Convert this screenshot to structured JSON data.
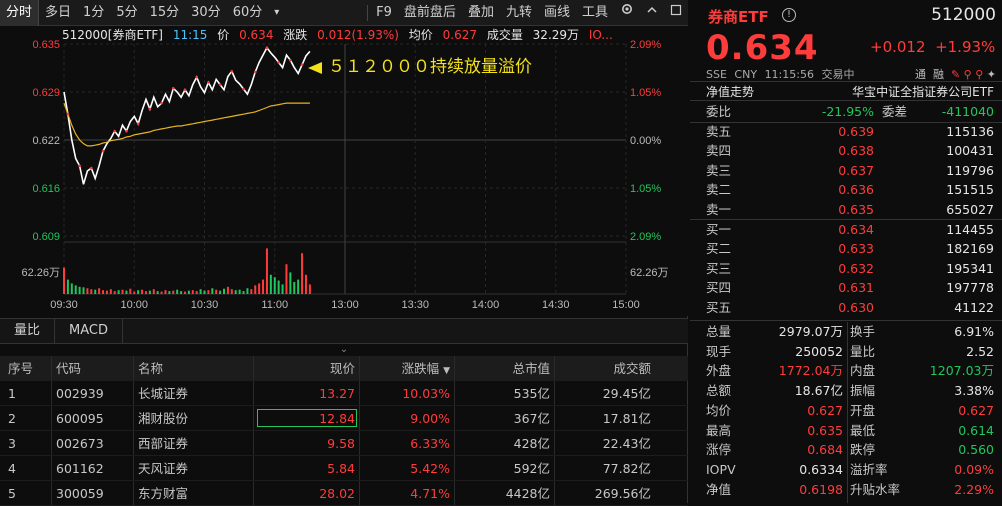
{
  "toolbar": {
    "tabs": [
      "分时",
      "多日",
      "1分",
      "5分",
      "15分",
      "30分",
      "60分",
      "▾"
    ],
    "tools": [
      "F9",
      "盘前盘后",
      "叠加",
      "九转",
      "画线",
      "工具"
    ]
  },
  "chart_info": {
    "code_name": "512000[券商ETF]",
    "time": "11:15",
    "price_label": "价",
    "price": "0.634",
    "chg_label": "涨跌",
    "chg": "0.012(1.93%)",
    "avg_label": "均价",
    "avg": "0.627",
    "vol_label": "成交量",
    "vol": "32.29万",
    "more": "IO..."
  },
  "annotation": "５１２０００持续放量溢价",
  "chart_data": {
    "type": "line",
    "title": "",
    "x_ticks": [
      "09:30",
      "10:00",
      "10:30",
      "11:00",
      "13:00",
      "13:30",
      "14:00",
      "14:30",
      "15:00"
    ],
    "y_left_ticks": [
      "0.635",
      "0.629",
      "0.622",
      "0.616",
      "0.609"
    ],
    "y_right_ticks": [
      "2.09%",
      "1.05%",
      "0.00%",
      "1.05%",
      "2.09%"
    ],
    "prev_close": 0.622,
    "ylim": [
      0.609,
      0.635
    ],
    "volume_label": "62.26万",
    "series": [
      {
        "name": "价",
        "color": "#ffffff",
        "values": [
          0.6285,
          0.6255,
          0.622,
          0.6195,
          0.6185,
          0.616,
          0.6178,
          0.6182,
          0.6168,
          0.6185,
          0.6205,
          0.6215,
          0.6222,
          0.6232,
          0.6225,
          0.624,
          0.6232,
          0.6245,
          0.6252,
          0.6242,
          0.626,
          0.6275,
          0.6262,
          0.6278,
          0.6265,
          0.627,
          0.6282,
          0.6272,
          0.629,
          0.6285,
          0.6278,
          0.6288,
          0.628,
          0.6295,
          0.6305,
          0.6292,
          0.6284,
          0.6298,
          0.6288,
          0.6302,
          0.6295,
          0.6288,
          0.6306,
          0.6313,
          0.6301,
          0.6296,
          0.6289,
          0.6282,
          0.6295,
          0.6312,
          0.6325,
          0.6335,
          0.6345,
          0.6338,
          0.6332,
          0.6325,
          0.6318,
          0.6335,
          0.6328,
          0.6318,
          0.631,
          0.6322,
          0.6334,
          0.634
        ]
      },
      {
        "name": "均价",
        "color": "#e6b422",
        "values": [
          0.627,
          0.6255,
          0.624,
          0.6228,
          0.622,
          0.6215,
          0.6212,
          0.6212,
          0.6213,
          0.6214,
          0.6216,
          0.6217,
          0.6219,
          0.622,
          0.6221,
          0.6222,
          0.6224,
          0.6225,
          0.6227,
          0.6228,
          0.6229,
          0.623,
          0.6231,
          0.6233,
          0.6234,
          0.6235,
          0.6236,
          0.6237,
          0.6238,
          0.6239,
          0.6239,
          0.624,
          0.6241,
          0.6242,
          0.6243,
          0.6244,
          0.6245,
          0.6246,
          0.6247,
          0.6248,
          0.6249,
          0.625,
          0.6251,
          0.6252,
          0.6253,
          0.6254,
          0.6255,
          0.6256,
          0.6257,
          0.6258,
          0.626,
          0.6262,
          0.6264,
          0.6266,
          0.6267,
          0.6268,
          0.6269,
          0.627,
          0.627,
          0.627,
          0.627,
          0.627,
          0.627,
          0.627
        ]
      }
    ],
    "volume": [
      0.55,
      0.3,
      0.22,
      0.18,
      0.15,
      0.14,
      0.12,
      0.1,
      0.09,
      0.12,
      0.08,
      0.07,
      0.1,
      0.06,
      0.08,
      0.09,
      0.07,
      0.11,
      0.05,
      0.08,
      0.09,
      0.06,
      0.07,
      0.1,
      0.06,
      0.05,
      0.08,
      0.06,
      0.07,
      0.09,
      0.06,
      0.05,
      0.07,
      0.08,
      0.06,
      0.1,
      0.07,
      0.08,
      0.12,
      0.09,
      0.07,
      0.11,
      0.15,
      0.1,
      0.08,
      0.09,
      0.06,
      0.12,
      0.1,
      0.18,
      0.22,
      0.3,
      0.95,
      0.4,
      0.35,
      0.28,
      0.2,
      0.62,
      0.45,
      0.25,
      0.3,
      0.85,
      0.4,
      0.2
    ]
  },
  "indicator_tabs": [
    "量比",
    "MACD"
  ],
  "table": {
    "headers": [
      "序号",
      "代码",
      "名称",
      "现价",
      "涨跌幅",
      "总市值",
      "成交额"
    ],
    "rows": [
      [
        "1",
        "002939",
        "长城证券",
        "13.27",
        "10.03%",
        "535亿",
        "29.45亿"
      ],
      [
        "2",
        "600095",
        "湘财股份",
        "12.84",
        "9.00%",
        "367亿",
        "17.81亿"
      ],
      [
        "3",
        "002673",
        "西部证券",
        "9.58",
        "6.33%",
        "428亿",
        "22.43亿"
      ],
      [
        "4",
        "601162",
        "天风证券",
        "5.84",
        "5.42%",
        "592亿",
        "77.82亿"
      ],
      [
        "5",
        "300059",
        "东方财富",
        "28.02",
        "4.71%",
        "4428亿",
        "269.56亿"
      ]
    ]
  },
  "quote": {
    "name": "券商ETF",
    "code": "512000",
    "price": "0.634",
    "change": "+0.012",
    "change_pct": "+1.93%",
    "exchange": "SSE",
    "currency": "CNY",
    "time": "11:15:56",
    "status": "交易中",
    "icons": [
      "通",
      "融",
      "✎",
      "⚲",
      "⚲",
      "✦"
    ],
    "nav_label": "净值走势",
    "index_name": "华宝中证全指证券公司ETF",
    "weibi_label": "委比",
    "weibi": "-21.95%",
    "weicha_label": "委差",
    "weicha": "-411040",
    "asks": [
      [
        "卖五",
        "0.639",
        "115136"
      ],
      [
        "卖四",
        "0.638",
        "100431"
      ],
      [
        "卖三",
        "0.637",
        "119796"
      ],
      [
        "卖二",
        "0.636",
        "151515"
      ],
      [
        "卖一",
        "0.635",
        "655027"
      ]
    ],
    "bids": [
      [
        "买一",
        "0.634",
        "114455"
      ],
      [
        "买二",
        "0.633",
        "182169"
      ],
      [
        "买三",
        "0.632",
        "195341"
      ],
      [
        "买四",
        "0.631",
        "197778"
      ],
      [
        "买五",
        "0.630",
        "41122"
      ]
    ],
    "stats": [
      [
        "总量",
        "2979.07万",
        "换手",
        "6.91%"
      ],
      [
        "现手",
        "250052",
        "量比",
        "2.52"
      ],
      [
        "外盘",
        "1772.04万",
        "内盘",
        "1207.03万"
      ],
      [
        "总额",
        "18.67亿",
        "振幅",
        "3.38%"
      ],
      [
        "均价",
        "0.627",
        "开盘",
        "0.627"
      ],
      [
        "最高",
        "0.635",
        "最低",
        "0.614"
      ],
      [
        "涨停",
        "0.684",
        "跌停",
        "0.560"
      ],
      [
        "IOPV",
        "0.6334",
        "溢折率",
        "0.09%"
      ],
      [
        "净值",
        "0.6198",
        "升贴水率",
        "2.29%"
      ]
    ]
  },
  "colors": {
    "up": "#ff3c3c",
    "down": "#22c55e",
    "price_line": "#ffffff",
    "avg_line": "#e6b422",
    "annotation": "#f3e21b"
  }
}
